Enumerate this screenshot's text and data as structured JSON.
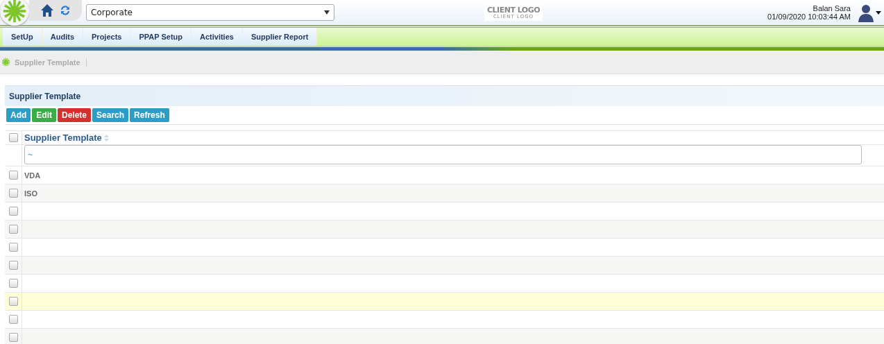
{
  "header": {
    "company_select": {
      "value": "Corporate"
    },
    "client_logo": {
      "title": "CLIENT LOGO",
      "subtitle": "CLIENT LOGO"
    },
    "user": {
      "name": "Balan Sara",
      "datetime": "01/09/2020 10:03:44 AM"
    }
  },
  "nav": {
    "tabs": [
      {
        "label": "SetUp",
        "selected": false
      },
      {
        "label": "Audits",
        "selected": false
      },
      {
        "label": "Projects",
        "selected": false
      },
      {
        "label": "PPAP Setup",
        "selected": false
      },
      {
        "label": "Activities",
        "selected": false
      },
      {
        "label": "Supplier Report",
        "selected": false
      }
    ]
  },
  "breadcrumb": [
    "Supplier Template"
  ],
  "panel": {
    "title": "Supplier Template",
    "buttons": [
      {
        "label": "Add",
        "color": "#2a9ec6"
      },
      {
        "label": "Edit",
        "color": "#3cac48"
      },
      {
        "label": "Delete",
        "color": "#d2322d"
      },
      {
        "label": "Search",
        "color": "#2a9ec6"
      },
      {
        "label": "Refresh",
        "color": "#2a9ec6"
      }
    ],
    "table": {
      "select_all": false,
      "column": "Supplier Template",
      "filter": {
        "value": "~"
      },
      "rows": [
        {
          "cell": "VDA",
          "checked": false,
          "highlighted": false
        },
        {
          "cell": "ISO",
          "checked": false,
          "highlighted": false
        },
        {
          "checked": false,
          "highlighted": false
        },
        {
          "checked": false,
          "highlighted": false
        },
        {
          "checked": false,
          "highlighted": false
        },
        {
          "checked": false,
          "highlighted": false
        },
        {
          "checked": false,
          "highlighted": false
        },
        {
          "checked": false,
          "highlighted": true
        },
        {
          "checked": false,
          "highlighted": false
        },
        {
          "checked": false,
          "highlighted": false
        }
      ]
    }
  }
}
